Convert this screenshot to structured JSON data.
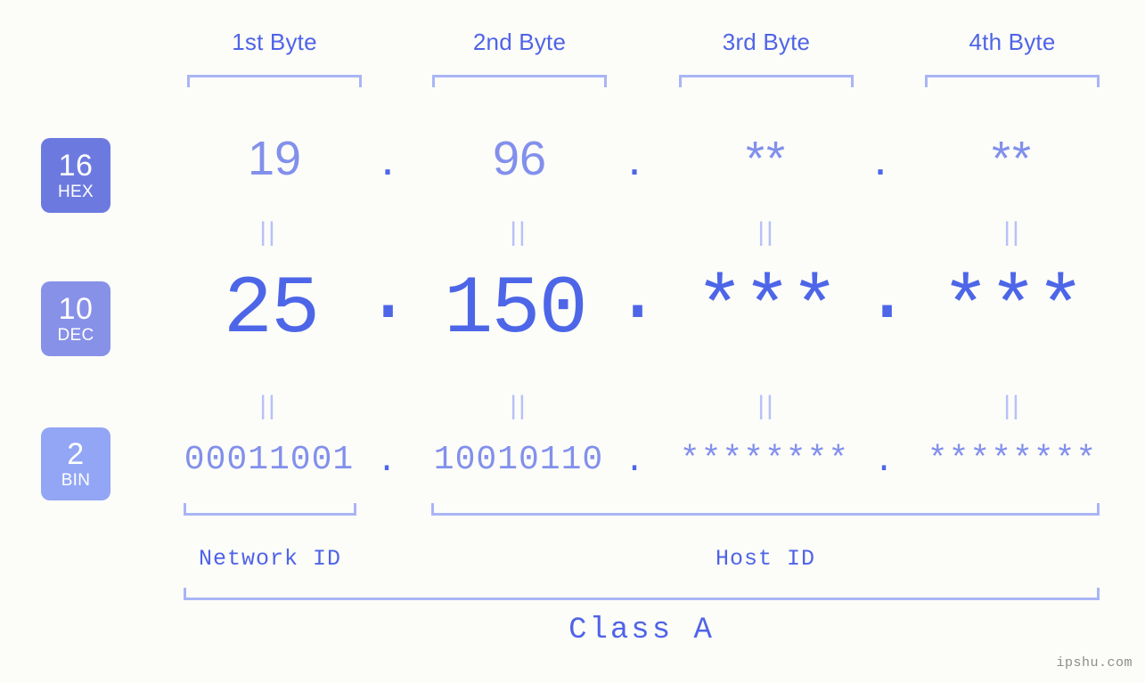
{
  "watermark": "ipshu.com",
  "background_color": "#fcfdf8",
  "accent_color": "#4d66e8",
  "light_accent_color": "#8290ec",
  "bracket_color": "#a9b5f5",
  "byte_headers": [
    {
      "label": "1st Byte"
    },
    {
      "label": "2nd Byte"
    },
    {
      "label": "3rd Byte"
    },
    {
      "label": "4th Byte"
    }
  ],
  "bases": [
    {
      "number": "16",
      "name": "HEX",
      "color": "#6c7ae0"
    },
    {
      "number": "10",
      "name": "DEC",
      "color": "#8791e8"
    },
    {
      "number": "2",
      "name": "BIN",
      "color": "#92a6f5"
    }
  ],
  "rows": {
    "hex": {
      "b1": "19",
      "b2": "96",
      "b3": "**",
      "b4": "**"
    },
    "dec": {
      "b1": "25",
      "b2": "150",
      "b3": "***",
      "b4": "***"
    },
    "bin": {
      "b1": "00011001",
      "b2": "10010110",
      "b3": "********",
      "b4": "********"
    }
  },
  "separators": {
    "dot": ".",
    "equals": "||"
  },
  "id_labels": {
    "network": "Network ID",
    "host": "Host ID"
  },
  "class_label": "Class A"
}
